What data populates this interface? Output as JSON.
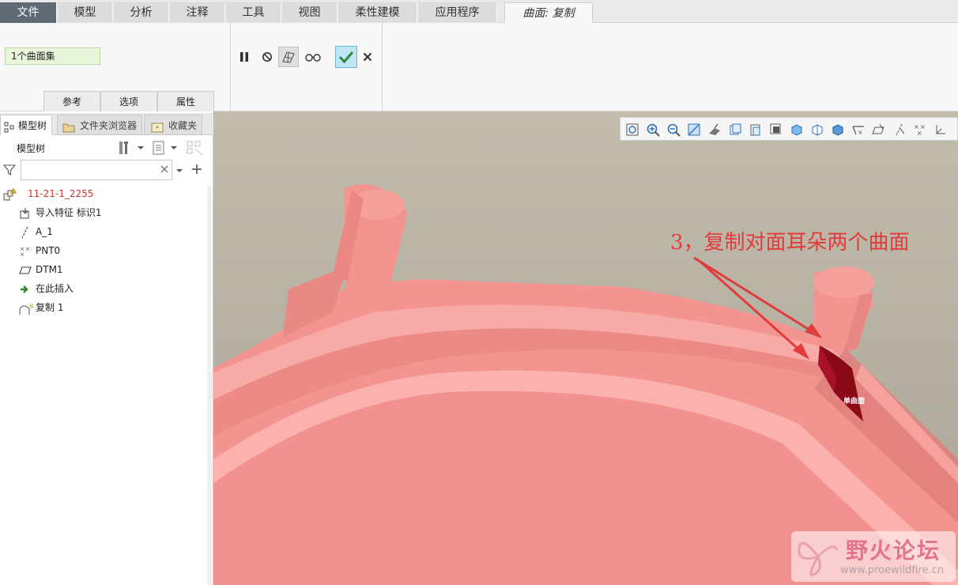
{
  "menu": {
    "tabs": [
      "文件",
      "模型",
      "分析",
      "注释",
      "工具",
      "视图",
      "柔性建模",
      "应用程序"
    ],
    "active_tab": "曲面: 复制"
  },
  "ribbon": {
    "selection_field": "1个曲面集",
    "panel_tabs": [
      "参考",
      "选项",
      "属性"
    ],
    "actions": [
      "pause-icon",
      "no-entry-icon",
      "preview-icon",
      "glasses-icon",
      "confirm-check-icon",
      "cancel-x-icon"
    ]
  },
  "left_panel": {
    "tabs": [
      "模型树",
      "文件夹浏览器",
      "收藏夹"
    ],
    "tree_title": "模型树",
    "filter_placeholder": "",
    "tree": [
      {
        "label": "11-21-1_2255",
        "icon": "part-icon",
        "color": "#c0392b"
      },
      {
        "label": "导入特征 标识1",
        "icon": "import-feature-icon",
        "color": "#222222"
      },
      {
        "label": "A_1",
        "icon": "axis-icon",
        "color": "#222222"
      },
      {
        "label": "PNT0",
        "icon": "datum-point-icon",
        "color": "#222222"
      },
      {
        "label": "DTM1",
        "icon": "datum-plane-icon",
        "color": "#222222"
      },
      {
        "label": "在此插入",
        "icon": "insert-here-arrow-icon",
        "color": "#222222"
      },
      {
        "label": "复制 1",
        "icon": "surface-copy-icon",
        "color": "#222222"
      }
    ]
  },
  "viewport": {
    "annotation": "3，复制对面耳朵两个曲面",
    "surface_label": "单曲面",
    "watermark_title": "野火论坛",
    "watermark_url": "www.proewildfire.cn",
    "colors": {
      "background": "#b8b3a4",
      "part": "#f39491",
      "part_light": "#f8aaa6",
      "selected_surface": "#8b0a18",
      "annotation": "#e23b3b"
    }
  }
}
